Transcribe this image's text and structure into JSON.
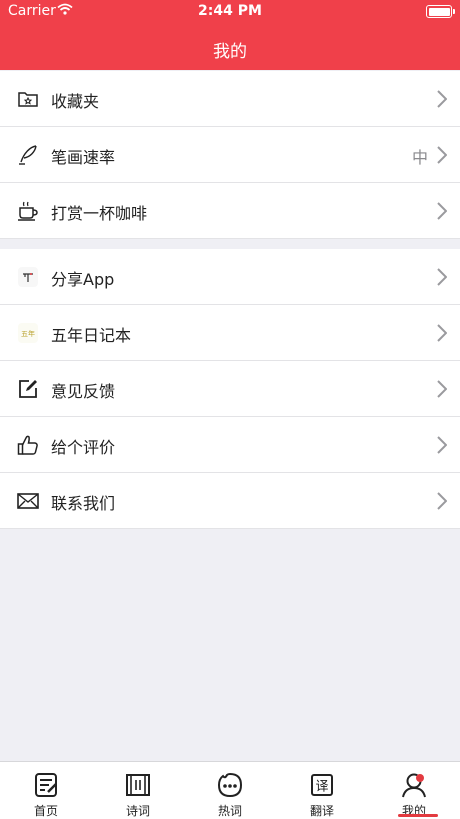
{
  "status_bar": {
    "carrier": "Carrier",
    "time": "2:44 PM"
  },
  "nav": {
    "title": "我的"
  },
  "group1": [
    {
      "label": "收藏夹",
      "icon": "folder-star-icon"
    },
    {
      "label": "笔画速率",
      "value": "中",
      "icon": "quill-pen-icon"
    },
    {
      "label": "打赏一杯咖啡",
      "icon": "coffee-cup-icon"
    }
  ],
  "group2": [
    {
      "label": "分享App",
      "icon": "share-app-icon"
    },
    {
      "label": "五年日记本",
      "icon": "diary-app-icon",
      "icon_text": "五年"
    },
    {
      "label": "意见反馈",
      "icon": "edit-feedback-icon"
    },
    {
      "label": "给个评价",
      "icon": "thumbs-up-icon"
    },
    {
      "label": "联系我们",
      "icon": "envelope-icon"
    }
  ],
  "tabs": [
    {
      "label": "首页",
      "icon": "home-doc-icon"
    },
    {
      "label": "诗词",
      "icon": "scroll-icon"
    },
    {
      "label": "热词",
      "icon": "chat-bubble-icon"
    },
    {
      "label": "翻译",
      "icon": "translate-icon",
      "icon_text": "译"
    },
    {
      "label": "我的",
      "icon": "person-icon",
      "selected": true
    }
  ],
  "colors": {
    "accent": "#f0404a",
    "tab_highlight": "#e33a40",
    "background": "#efeff4"
  }
}
